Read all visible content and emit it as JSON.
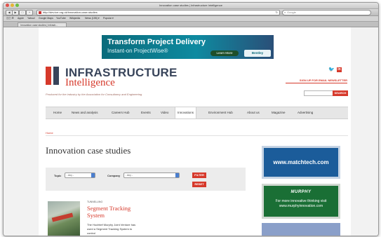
{
  "browser": {
    "window_title": "Innovation case studies | Infrastructure Intelligence",
    "url": "http://dev.ice.org.uk/innovation-case-studies",
    "search_placeholder": "Google",
    "bookmarks": [
      "Apple",
      "Yahoo!",
      "Google Maps",
      "YouTube",
      "Wikipedia",
      "News (155) ▾",
      "Popular ▾"
    ],
    "tab_title": "Innovation case studies | Infrastr..."
  },
  "banner": {
    "title": "Transform Project Delivery",
    "subtitle": "Instant-on ProjectWise®",
    "cta": "Learn More",
    "brand": "Bentley"
  },
  "site": {
    "brand_main": "INFRASTRUCTURE",
    "brand_sub": "Intelligence",
    "tagline": "Produced for the industry by the Association for Consultancy and Engineering",
    "signup": "SIGN UP FOR EMAIL NEWSLETTER",
    "search_button": "SEARCH"
  },
  "nav": {
    "items": [
      "Home",
      "News and analysis",
      "Careers Hub",
      "Events",
      "Video",
      "Innovations",
      "Environment Hub",
      "About us",
      "Magazine",
      "Advertising"
    ]
  },
  "breadcrumb": "Home",
  "page": {
    "title": "Innovation case studies"
  },
  "filter": {
    "topic_label": "Topic",
    "topic_value": "- Any -",
    "company_label": "Company",
    "company_value": "- Any -",
    "filter_button": "FILTER",
    "reset_button": "RESET"
  },
  "article": {
    "category": "TUNNELLING",
    "title": "Segment Tracking System",
    "body": "The Hochtief Murphy Joint Venture has used a Segment Tracking System to control"
  },
  "ads": {
    "matchtech": "www.matchtech.com",
    "murphy_brand": "MURPHY",
    "murphy_text": "For more innovative thinking visit www.murphyinnovation.com"
  },
  "colors": {
    "brand_red": "#d6392b",
    "brand_navy": "#38445a"
  }
}
